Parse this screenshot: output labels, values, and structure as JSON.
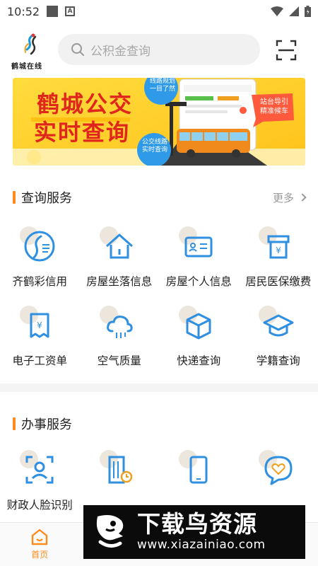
{
  "status_bar": {
    "time": "10:52"
  },
  "header": {
    "logo_text": "鹤城在线",
    "search_placeholder": "公积金查询"
  },
  "banner": {
    "title_line1": "鹤城公交",
    "title_line2": "实时查询",
    "bubble_top": "线路规划一目了然",
    "bubble_left": "公交线路实时查询",
    "bubble_right": "站台导引精准候车"
  },
  "query_services": {
    "title": "查询服务",
    "more_label": "更多",
    "items": [
      {
        "label": "齐鹤彩信用",
        "icon": "crane-logo-icon"
      },
      {
        "label": "房屋坐落信息",
        "icon": "house-icon"
      },
      {
        "label": "房屋个人信息",
        "icon": "id-card-icon"
      },
      {
        "label": "居民医保缴费",
        "icon": "yuan-receipt-icon"
      },
      {
        "label": "电子工资单",
        "icon": "payslip-icon"
      },
      {
        "label": "空气质量",
        "icon": "cloud-icon"
      },
      {
        "label": "快递查询",
        "icon": "package-icon"
      },
      {
        "label": "学籍查询",
        "icon": "graduation-cap-icon"
      }
    ]
  },
  "affairs_services": {
    "title": "办事服务",
    "items": [
      {
        "label": "财政人脸识别",
        "icon": "face-scan-icon"
      },
      {
        "label": "",
        "icon": "building-clock-icon"
      },
      {
        "label": "",
        "icon": "phone-icon"
      },
      {
        "label": "",
        "icon": "heart-chat-icon"
      }
    ]
  },
  "bottom_nav": {
    "items": [
      {
        "label": "首页",
        "icon": "home-icon",
        "active": true
      },
      {
        "label": "",
        "icon": "nav-icon-2",
        "active": false
      },
      {
        "label": "",
        "icon": "nav-icon-3",
        "active": false
      },
      {
        "label": "",
        "icon": "nav-icon-4",
        "active": false
      }
    ]
  },
  "watermark": {
    "title": "下载鸟资源",
    "url": "www.xiazainiao.com"
  },
  "colors": {
    "accent": "#ff8a1c",
    "icon_blue": "#2f8fe0",
    "banner_yellow": "#ffd233"
  }
}
